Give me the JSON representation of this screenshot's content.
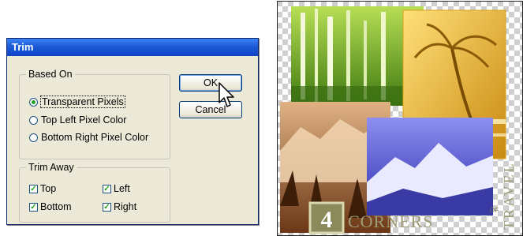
{
  "dialog": {
    "title": "Trim",
    "based_on": {
      "legend": "Based On",
      "options": [
        {
          "label": "Transparent Pixels",
          "selected": true
        },
        {
          "label": "Top Left Pixel Color",
          "selected": false
        },
        {
          "label": "Bottom Right Pixel Color",
          "selected": false
        }
      ]
    },
    "trim_away": {
      "legend": "Trim Away",
      "checkboxes": [
        {
          "label": "Top",
          "checked": true
        },
        {
          "label": "Left",
          "checked": true
        },
        {
          "label": "Bottom",
          "checked": true
        },
        {
          "label": "Right",
          "checked": true
        }
      ]
    },
    "buttons": {
      "ok": "OK",
      "cancel": "Cancel"
    }
  },
  "image": {
    "numeral": "4",
    "word": "CORNERS",
    "small": "OF",
    "vertical": "TRAVEL"
  },
  "colors": {
    "title_bar": "#0d46c8",
    "dialog_bg": "#ece9d8",
    "green_tile": "#7ab01c",
    "yellow_tile": "#e9b520",
    "brown_tile": "#9a5a2a",
    "blue_tile": "#5b5fd4"
  }
}
